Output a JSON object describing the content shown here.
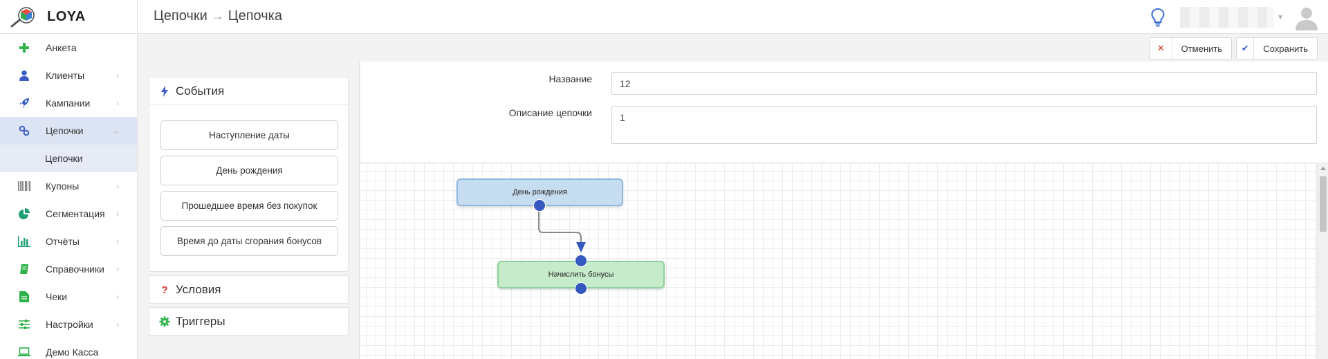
{
  "app": {
    "logo_text": "LOYA"
  },
  "breadcrumb": {
    "parent": "Цепочки",
    "separator": "→",
    "current": "Цепочка"
  },
  "sidebar": {
    "items": [
      {
        "label": "Анкета",
        "icon": "plus-icon",
        "color": "#2eb24a",
        "has_chevron": false
      },
      {
        "label": "Клиенты",
        "icon": "user-icon",
        "color": "#3b5fc7",
        "has_chevron": true
      },
      {
        "label": "Кампании",
        "icon": "rocket-icon",
        "color": "#3b5fc7",
        "has_chevron": true
      },
      {
        "label": "Цепочки",
        "icon": "link-icon",
        "color": "#3b5fc7",
        "has_chevron": true,
        "active": true
      },
      {
        "label": "Купоны",
        "icon": "barcode-icon",
        "color": "#888888",
        "has_chevron": true
      },
      {
        "label": "Сегментация",
        "icon": "pie-chart-icon",
        "color": "#1d9e74",
        "has_chevron": true
      },
      {
        "label": "Отчёты",
        "icon": "bar-chart-icon",
        "color": "#1d9e74",
        "has_chevron": true
      },
      {
        "label": "Справочники",
        "icon": "book-icon",
        "color": "#2eb24a",
        "has_chevron": true
      },
      {
        "label": "Чеки",
        "icon": "receipt-icon",
        "color": "#2eb24a",
        "has_chevron": true
      },
      {
        "label": "Настройки",
        "icon": "sliders-icon",
        "color": "#2eb24a",
        "has_chevron": true
      },
      {
        "label": "Демо Касса",
        "icon": "laptop-icon",
        "color": "#2eb24a",
        "has_chevron": false
      }
    ],
    "sub_item": "Цепочки"
  },
  "actions": {
    "cancel_label": "Отменить",
    "save_label": "Сохранить"
  },
  "panels": {
    "events": {
      "title": "События",
      "buttons": [
        "Наступление даты",
        "День рождения",
        "Прошедшее время без покупок",
        "Время до даты сгорания бонусов"
      ]
    },
    "conditions": {
      "title": "Условия"
    },
    "triggers": {
      "title": "Триггеры"
    }
  },
  "form": {
    "name_label": "Название",
    "name_value": "12",
    "description_label": "Описание цепочки",
    "description_value": "1"
  },
  "canvas": {
    "nodes": [
      {
        "label": "День рождения",
        "kind": "event"
      },
      {
        "label": "Начислить бонусы",
        "kind": "action"
      }
    ]
  },
  "colors": {
    "accent": "#3b5fc7",
    "event_node": "#c6dcf1",
    "action_node": "#c5ebca",
    "cancel": "#d9342b"
  }
}
